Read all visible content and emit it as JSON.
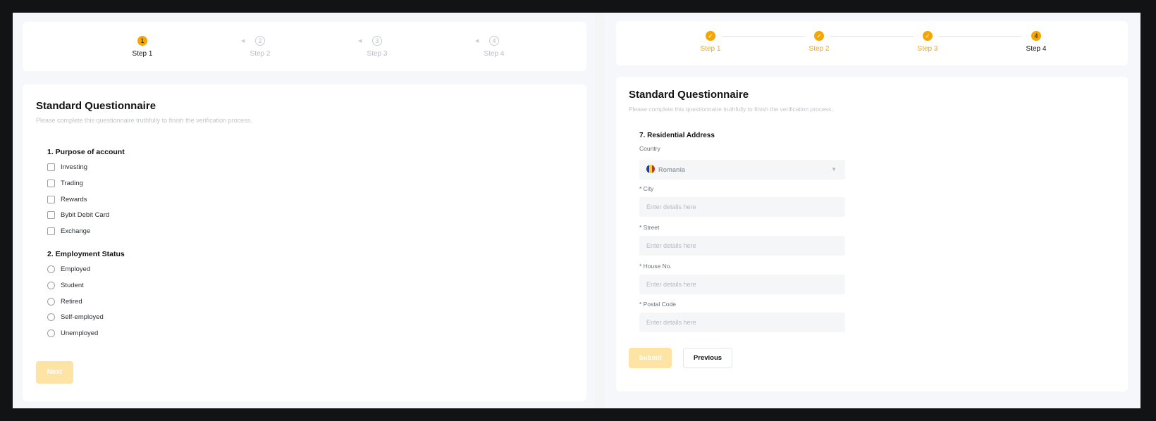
{
  "left": {
    "stepper": [
      {
        "number": "1",
        "label": "Step 1"
      },
      {
        "number": "2",
        "label": "Step 2"
      },
      {
        "number": "3",
        "label": "Step 3"
      },
      {
        "number": "4",
        "label": "Step 4"
      }
    ],
    "title": "Standard Questionnaire",
    "subtitle": "Please complete this questionnaire truthfully to finish the verification process.",
    "q1": {
      "title": "1. Purpose of account",
      "options": [
        "Investing",
        "Trading",
        "Rewards",
        "Bybit Debit Card",
        "Exchange"
      ]
    },
    "q2": {
      "title": "2. Employment Status",
      "options": [
        "Employed",
        "Student",
        "Retired",
        "Self-employed",
        "Unemployed"
      ]
    },
    "next_label": "Next"
  },
  "right": {
    "stepper": [
      {
        "number": "✓",
        "label": "Step 1"
      },
      {
        "number": "✓",
        "label": "Step 2"
      },
      {
        "number": "✓",
        "label": "Step 3"
      },
      {
        "number": "4",
        "label": "Step 4"
      }
    ],
    "title": "Standard Questionnaire",
    "subtitle": "Please complete this questionnaire truthfully to finish the verification process.",
    "section_title": "7. Residential Address",
    "country_label": "Country",
    "country_value": "Romania",
    "fields": [
      {
        "label": "* City",
        "placeholder": "Enter details here"
      },
      {
        "label": "* Street",
        "placeholder": "Enter details here"
      },
      {
        "label": "* House No.",
        "placeholder": "Enter details here"
      },
      {
        "label": "* Postal Code",
        "placeholder": "Enter details here"
      }
    ],
    "submit_label": "Submit",
    "previous_label": "Previous"
  },
  "colors": {
    "accent": "#f7a600",
    "accent_disabled": "#fde4a4",
    "background": "#121314"
  }
}
